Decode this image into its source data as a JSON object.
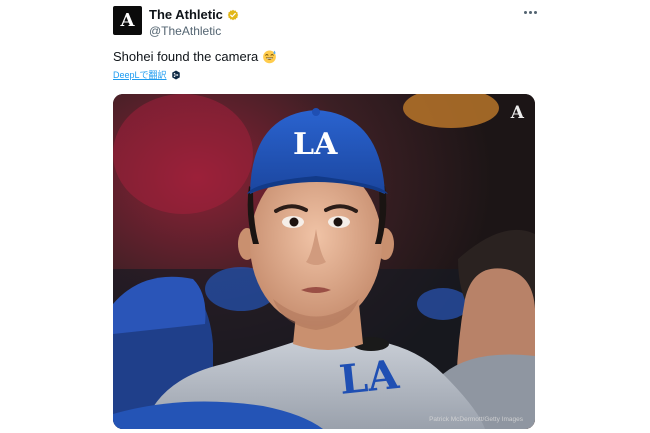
{
  "author": {
    "display_name": "The Athletic",
    "handle": "@TheAthletic",
    "avatar_letter": "A",
    "verified_icon": "gold-verified-badge-icon"
  },
  "tweet": {
    "text": "Shohei found the camera",
    "emoji_icon": "grinning-sweat-emoji-icon",
    "translate_label": "DeepLで翻訳",
    "translate_icon": "deepl-icon"
  },
  "media": {
    "credit": "Patrick McDermott/Getty Images",
    "watermark": "A",
    "cap_logo": "LA",
    "jersey_logo": "LA"
  },
  "colors": {
    "accent_link": "#1d9bf0",
    "text_primary": "#0f1419",
    "text_secondary": "#536471",
    "verified_gold": "#e2b719",
    "dodger_blue": "#1f4fb3"
  }
}
